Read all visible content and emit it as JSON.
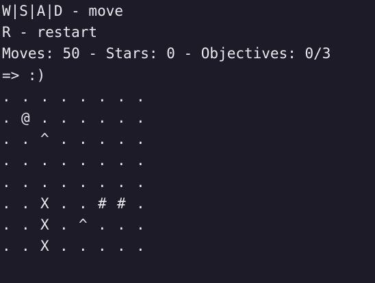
{
  "colors": {
    "background": "#1d1b28",
    "text": "#e8e8ef"
  },
  "header": {
    "controls_move": "W|S|A|D - move",
    "controls_restart": "R - restart",
    "status": "Moves: 50 - Stars: 0 - Objectives: 0/3",
    "mood": "=> :)"
  },
  "board": {
    "rows": [
      [
        ".",
        ".",
        ".",
        ".",
        ".",
        ".",
        ".",
        "."
      ],
      [
        ".",
        "@",
        ".",
        ".",
        ".",
        ".",
        ".",
        "."
      ],
      [
        ".",
        ".",
        "^",
        ".",
        ".",
        ".",
        ".",
        "."
      ],
      [
        ".",
        ".",
        ".",
        ".",
        ".",
        ".",
        ".",
        "."
      ],
      [
        ".",
        ".",
        ".",
        ".",
        ".",
        ".",
        ".",
        "."
      ],
      [
        ".",
        ".",
        "X",
        ".",
        ".",
        "#",
        "#",
        "."
      ],
      [
        ".",
        ".",
        "X",
        ".",
        "^",
        ".",
        ".",
        "."
      ],
      [
        ".",
        ".",
        "X",
        ".",
        ".",
        ".",
        ".",
        "."
      ]
    ]
  }
}
